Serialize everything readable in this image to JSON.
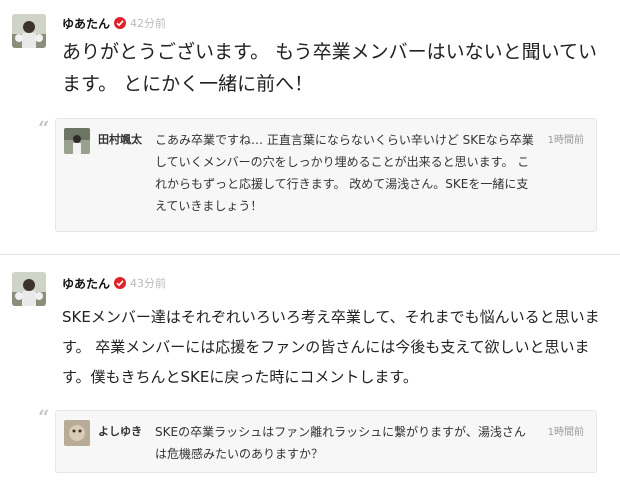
{
  "posts": [
    {
      "author": "ゆあたん",
      "time": "42分前",
      "body": "ありがとうございます。 もう卒業メンバーはいないと聞いています。 とにかく一緒に前へ！",
      "reply": {
        "author": "田村颯太",
        "time": "1時間前",
        "text": "こあみ卒業ですね… 正直言葉にならないくらい辛いけど SKEなら卒業していくメンバーの穴をしっかり埋めることが出来ると思います。 これからもずっと応援して行きます。 改めて湯浅さん。SKEを一緒に支えていきましょう！"
      }
    },
    {
      "author": "ゆあたん",
      "time": "43分前",
      "body": "SKEメンバー達はそれぞれいろいろ考え卒業して、それまでも悩んいると思います。 卒業メンバーには応援をファンの皆さんには今後も支えて欲しいと思います。僕もきちんとSKEに戻った時にコメントします。",
      "reply": {
        "author": "よしゆき",
        "time": "1時間前",
        "text": "SKEの卒業ラッシュはファン離れラッシュに繋がりますが、湯浅さんは危機感みたいのありますか？"
      }
    }
  ],
  "colors": {
    "verified": "#e0202a",
    "timestamp": "#b9b9b9",
    "reply_bg": "#f7f7f7"
  },
  "icons": {
    "verified": "check-badge-icon",
    "quote": "quote-icon"
  }
}
